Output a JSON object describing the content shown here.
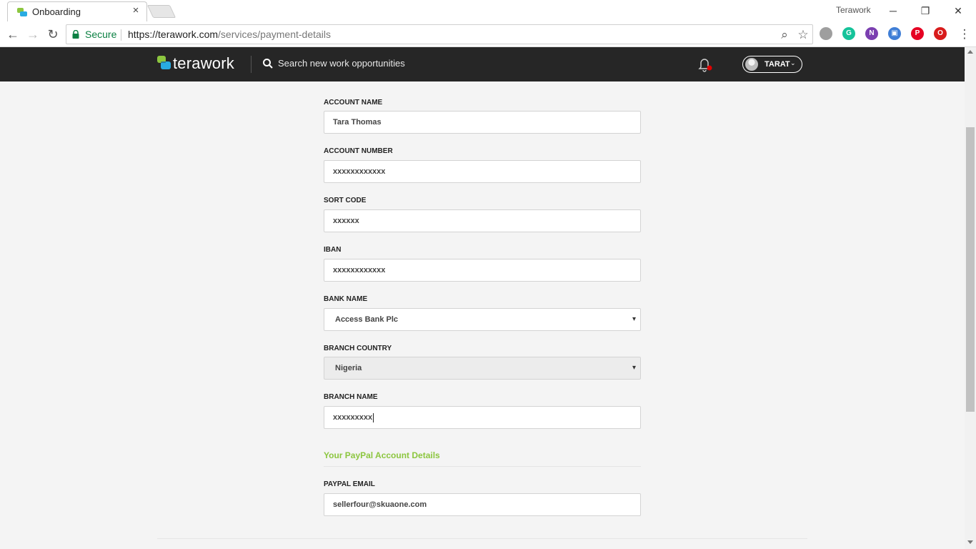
{
  "browser": {
    "tab_title": "Onboarding",
    "tab_close": "×",
    "window_title": "Terawork",
    "window_buttons": {
      "minimize": "─",
      "restore": "❐",
      "close": "✕"
    },
    "nav": {
      "back": "←",
      "forward": "→",
      "reload": "↻"
    },
    "secure_label": "Secure",
    "url_host": "https://terawork.com",
    "url_path": "/services/payment-details",
    "zoom_icon": "⌕",
    "star_icon": "☆",
    "extensions": [
      {
        "name": "extension-grey-icon",
        "color": "#9e9e9e",
        "glyph": ""
      },
      {
        "name": "grammarly-icon",
        "color": "#15c39a",
        "glyph": "G"
      },
      {
        "name": "onenote-icon",
        "color": "#7b3fb0",
        "glyph": "N"
      },
      {
        "name": "extension-blue-icon",
        "color": "#3f7ed6",
        "glyph": "▣"
      },
      {
        "name": "pinterest-icon",
        "color": "#e60023",
        "glyph": "P"
      },
      {
        "name": "opera-icon",
        "color": "#d81c1c",
        "glyph": "O"
      }
    ],
    "menu_icon": "⋮"
  },
  "header": {
    "logo_text": "terawork",
    "search_text": "Search new work opportunities",
    "user_name": "TARAT",
    "user_caret": "⌄",
    "colors": {
      "bar": "#262626",
      "logo_green": "#8cc63f",
      "logo_blue": "#29abe2",
      "notify": "#e00000"
    }
  },
  "form": {
    "fields": [
      {
        "label": "ACCOUNT NAME",
        "value": "Tara Thomas"
      },
      {
        "label": "ACCOUNT NUMBER",
        "value": "xxxxxxxxxxxx"
      },
      {
        "label": "SORT CODE",
        "value": "xxxxxx"
      },
      {
        "label": "IBAN",
        "value": "xxxxxxxxxxxx"
      },
      {
        "label": "BANK NAME",
        "value": "Access Bank Plc"
      },
      {
        "label": "BRANCH COUNTRY",
        "value": "Nigeria"
      },
      {
        "label": "BRANCH NAME",
        "value": "xxxxxxxxx"
      }
    ],
    "select_caret": "▾",
    "paypal": {
      "section_title": "Your PayPal Account Details",
      "email_label": "PAYPAL EMAIL",
      "email_value": "sellerfour@skuaone.com"
    }
  }
}
